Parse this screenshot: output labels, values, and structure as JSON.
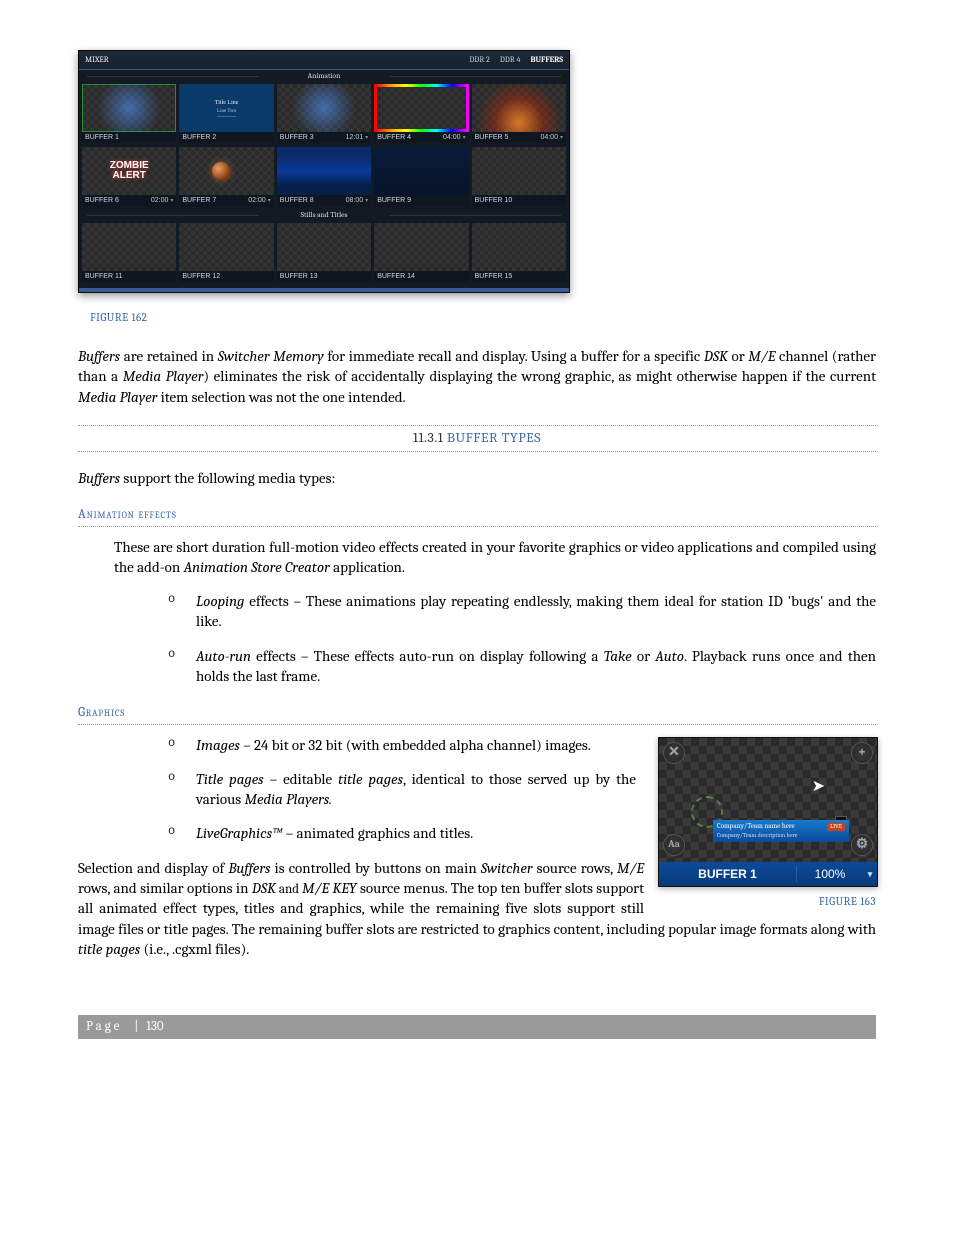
{
  "figure162": {
    "caption": "FIGURE 162",
    "topLeft": "MIXER",
    "tabs": [
      "DDR 2",
      "DDR 4",
      "BUFFERS"
    ],
    "activeTab": "BUFFERS",
    "sectionAnimation": "Animation",
    "sectionStills": "Stills and Titles",
    "row1": [
      {
        "label": "BUFFER 1",
        "thumb": "lightblue",
        "sel": "green"
      },
      {
        "label": "BUFFER 2",
        "thumb": "title",
        "t1": "Title Line",
        "t2": "Line Two"
      },
      {
        "label": "BUFFER 3",
        "time": "12:01",
        "dd": "▾",
        "thumb": "lightblue"
      },
      {
        "label": "BUFFER 4",
        "time": "04:00",
        "dd": "▾",
        "thumb": "rainbow",
        "sel": "blue"
      },
      {
        "label": "BUFFER 5",
        "time": "04:00",
        "dd": "▾",
        "thumb": "fire"
      }
    ],
    "row2": [
      {
        "label": "BUFFER 6",
        "time": "02:00",
        "dd": "▾",
        "thumb": "zombie"
      },
      {
        "label": "BUFFER 7",
        "time": "02:00",
        "dd": "▾",
        "thumb": "planet"
      },
      {
        "label": "BUFFER 8",
        "time": "08:00",
        "dd": "▾",
        "thumb": "deepblue"
      },
      {
        "label": "BUFFER 9",
        "thumb": "darkblue"
      },
      {
        "label": "BUFFER 10",
        "thumb": ""
      }
    ],
    "row3": [
      {
        "label": "BUFFER 11"
      },
      {
        "label": "BUFFER 12"
      },
      {
        "label": "BUFFER 13"
      },
      {
        "label": "BUFFER 14"
      },
      {
        "label": "BUFFER 15"
      }
    ]
  },
  "para1": {
    "t1": "Buffers",
    "t2": " are retained in ",
    "t3": "Switcher Memory",
    "t4": " for immediate recall and display.  Using a buffer for a specific ",
    "t5": "DSK",
    "t6": " or ",
    "t7": "M/E",
    "t8": " channel (rather than a ",
    "t9": "Media Player",
    "t10": ") eliminates the risk of accidentally displaying the wrong graphic, as might otherwise happen if the current ",
    "t11": "Media Player",
    "t12": " item selection was not the one intended."
  },
  "sectionHeader": {
    "num": "11.3.1",
    "title": "BUFFER TYPES"
  },
  "para2": {
    "t1": "Buffers",
    "t2": " support the following media types:"
  },
  "animHdr": "Animation effects",
  "animIntro": {
    "t1": "These are short duration full-motion video effects created in your favorite graphics or video applications and compiled using the add-on ",
    "t2": "Animation Store Creator",
    "t3": " application."
  },
  "animList": [
    {
      "i1": "Looping",
      "i2": " effects – These animations play repeating endlessly, making them ideal for station ID 'bugs' and the like."
    },
    {
      "i1": "Auto-run",
      "i2": " effects – These effects auto-run on display following a ",
      "i3": "Take",
      "i4": " or ",
      "i5": "Auto",
      "i6": ".  Playback runs once and then holds the last frame."
    }
  ],
  "graphicsHdr": "Graphics",
  "graphicsList": [
    {
      "i1": "Images",
      "i2": " – 24 bit or 32 bit (with embedded alpha channel) images."
    },
    {
      "i1": "Title pages",
      "i2": " – editable ",
      "i3": "title pages",
      "i4": ", identical to those served up by the various ",
      "i5": "Media Players."
    },
    {
      "i1": "LiveGraphics™",
      "i2": " – animated graphics and titles."
    }
  ],
  "figure163": {
    "caption": "FIGURE 163",
    "close": "✕",
    "plus": "+",
    "aa": "Aa",
    "gear": "⚙",
    "nameLine": "Company/Team name here",
    "descLine": "Company/Team description here",
    "badge": "LIVE",
    "barLabel": "BUFFER 1",
    "barPct": "100%",
    "barDd": "▾"
  },
  "para3": {
    "t1": "Selection and display of ",
    "t2": "Buffers",
    "t3": " is controlled by buttons on main ",
    "t4": "Switcher",
    "t5": " source rows, ",
    "t6": "M/E",
    "t7": " rows, and similar options in ",
    "t8": "DSK",
    "t9": " and ",
    "t10": "M/E KEY",
    "t11": " source menus.  The top ten buffer slots support all animated effect types, titles and graphics, while the remaining five slots support still image files or title pages.  The remaining buffer slots are restricted to graphics content, including popular image formats along with ",
    "t12": "title pages",
    "t13": " (i.e., .cgxml files)."
  },
  "footer": {
    "word": "Page",
    "sep": "|",
    "num": "130"
  }
}
